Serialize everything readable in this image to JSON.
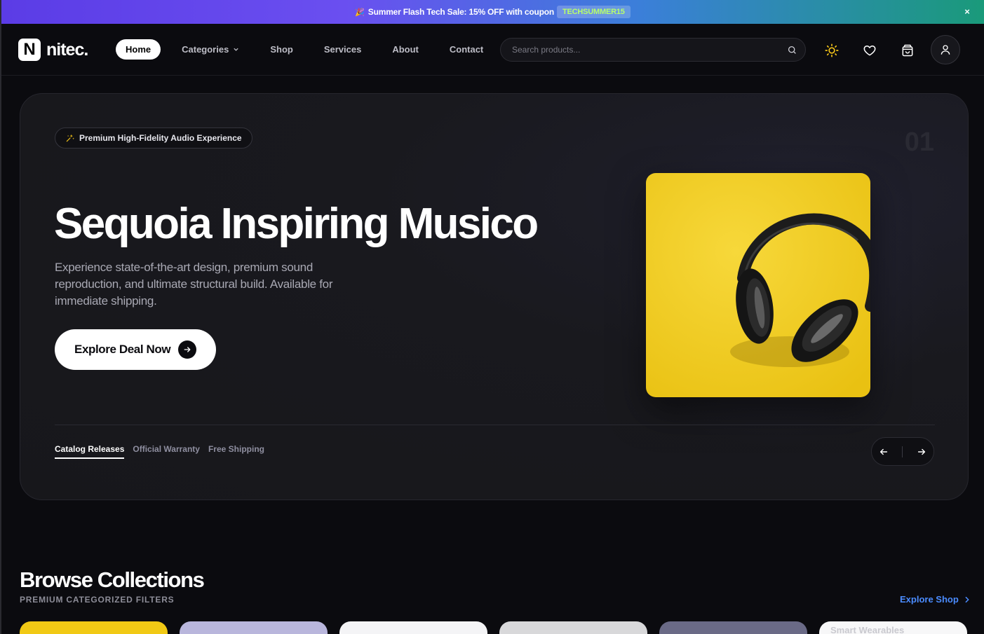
{
  "promo": {
    "text": "Summer Flash Tech Sale: 15% OFF with coupon",
    "coupon": "TECHSUMMER15",
    "close": "×"
  },
  "header": {
    "logo_mark": "N",
    "logo_text": "nitec.",
    "nav": [
      {
        "label": "Home",
        "active": true
      },
      {
        "label": "Categories",
        "dropdown": true
      },
      {
        "label": "Shop"
      },
      {
        "label": "Services"
      },
      {
        "label": "About"
      },
      {
        "label": "Contact"
      }
    ],
    "search_placeholder": "Search products...",
    "icons": [
      "search-icon",
      "sun-icon",
      "heart-icon",
      "cart-icon",
      "user-icon"
    ]
  },
  "hero": {
    "badge": "Premium High-Fidelity Audio Experience",
    "slide_number": "01",
    "title": "Sequoia Inspiring Musico",
    "description": "Experience state-of-the-art design, premium sound reproduction, and ultimate structural build. Available for immediate shipping.",
    "cta_label": "Explore Deal Now",
    "tabs": [
      "Catalog Releases",
      "Official Warranty",
      "Free Shipping"
    ]
  },
  "browse": {
    "title": "Browse Collections",
    "subtitle": "PREMIUM CATEGORIZED FILTERS",
    "explore_link": "Explore Shop",
    "cards": [
      {
        "bg": "#f1c915",
        "label": ""
      },
      {
        "bg": "#b9b6dc",
        "label": ""
      },
      {
        "bg": "#f4f4f6",
        "label": ""
      },
      {
        "bg": "#d8d8da",
        "label": ""
      },
      {
        "bg": "#6a6a86",
        "label": ""
      },
      {
        "bg": "#f7f7f8",
        "label": "Smart Wearables"
      }
    ]
  },
  "colors": {
    "accent": "#4b8cff",
    "coupon": "#b8ff6a",
    "sun": "#f5c518",
    "product_bg": "#f0cd1c"
  }
}
